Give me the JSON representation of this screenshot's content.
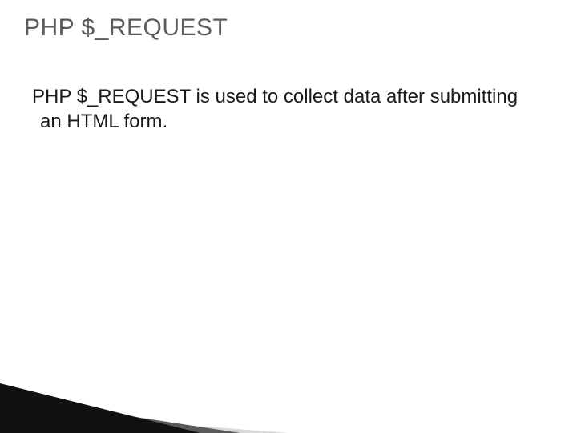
{
  "slide": {
    "title": "PHP $_REQUEST",
    "body": "PHP $_REQUEST is used to collect data after submitting an HTML form."
  }
}
